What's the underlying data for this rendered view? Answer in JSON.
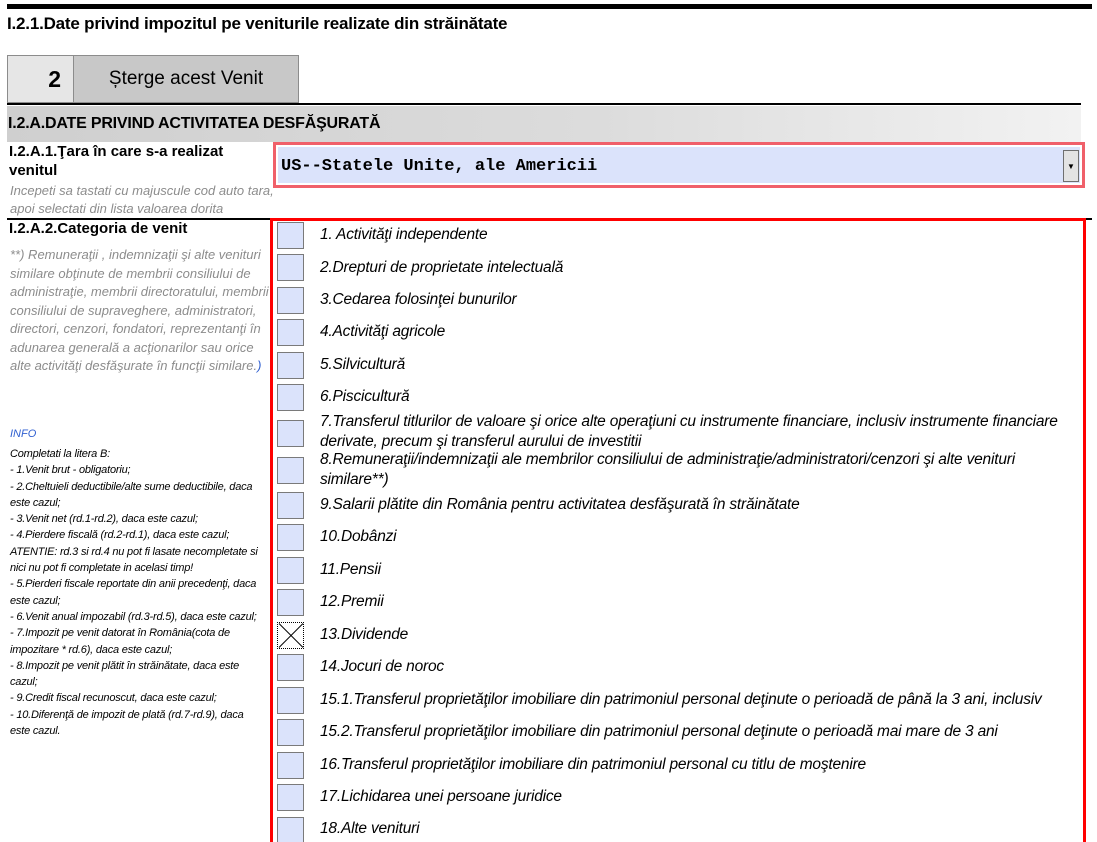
{
  "section": {
    "title": "I.2.1.Date privind impozitul pe veniturile realizate din străinătate"
  },
  "venit": {
    "number": "2",
    "delete_label": "Șterge acest Venit"
  },
  "activity": {
    "header": "I.2.A.DATE PRIVIND ACTIVITATEA DESFĂŞURATĂ",
    "country_label": "I.2.A.1.Ţara în care s-a realizat venitul",
    "country_hint": "Incepeti sa tastati cu majuscule cod auto tara, apoi selectati din lista valoarea dorita",
    "country_value": "US--Statele Unite, ale Americii",
    "category_label": "I.2.A.2.Categoria de venit",
    "category_note": "**) Remuneraţii , indemnizaţii şi alte venituri similare obţinute de membrii consiliului de administraţie, membrii directoratului, membrii consiliului de supraveghere, administratori, directori, cenzori, fondatori, reprezentanţi în adunarea generală a acţionarilor sau orice alte activităţi desfăşurate în funcţii similare.",
    "category_note_end": ")"
  },
  "info": {
    "title": "INFO",
    "lines": [
      "Completati la litera B:",
      "- 1.Venit brut - obligatoriu;",
      "- 2.Cheltuieli deductibile/alte sume deductibile, daca este cazul;",
      "- 3.Venit net (rd.1-rd.2), daca este cazul;",
      "- 4.Pierdere fiscală (rd.2-rd.1), daca este cazul;",
      "ATENTIE: rd.3 si rd.4 nu pot fi lasate necompletate si nici nu pot fi completate in acelasi timp!",
      "- 5.Pierderi fiscale reportate din anii precedenţi, daca este cazul;",
      "- 6.Venit anual impozabil (rd.3-rd.5), daca este cazul;",
      "- 7.Impozit pe venit datorat în România(cota de impozitare * rd.6), daca este cazul;",
      "- 8.Impozit pe venit plătit în străinătate, daca este cazul;",
      "- 9.Credit fiscal recunoscut, daca este cazul;",
      "- 10.Diferenţă de impozit de plată (rd.7-rd.9), daca este cazul."
    ]
  },
  "categories": [
    {
      "label": "1. Activităţi independente",
      "checked": false
    },
    {
      "label": "2.Drepturi de proprietate intelectuală",
      "checked": false
    },
    {
      "label": "3.Cedarea folosinţei bunurilor",
      "checked": false
    },
    {
      "label": "4.Activităţi agricole",
      "checked": false
    },
    {
      "label": "5.Silvicultură",
      "checked": false
    },
    {
      "label": "6.Piscicultură",
      "checked": false
    },
    {
      "label": "7.Transferul titlurilor de valoare şi orice alte operaţiuni cu instrumente financiare, inclusiv instrumente financiare derivate, precum şi transferul aurului de investitii",
      "checked": false
    },
    {
      "label": "8.Remuneraţii/indemnizaţii ale membrilor consiliului de administraţie/administratori/cenzori şi alte venituri similare**)",
      "checked": false
    },
    {
      "label": "9.Salarii plătite din România pentru activitatea desfăşurată în străinătate",
      "checked": false
    },
    {
      "label": "10.Dobânzi",
      "checked": false
    },
    {
      "label": "11.Pensii",
      "checked": false
    },
    {
      "label": "12.Premii",
      "checked": false
    },
    {
      "label": "13.Dividende",
      "checked": true
    },
    {
      "label": "14.Jocuri de noroc",
      "checked": false
    },
    {
      "label": "15.1.Transferul proprietăţilor imobiliare din patrimoniul personal deţinute o perioadă de până la 3 ani, inclusiv",
      "checked": false
    },
    {
      "label": "15.2.Transferul proprietăţilor imobiliare din patrimoniul personal deţinute o perioadă mai mare de 3 ani",
      "checked": false
    },
    {
      "label": "16.Transferul proprietăţilor imobiliare din patrimoniul personal cu titlu de moştenire",
      "checked": false
    },
    {
      "label": "17.Lichidarea unei persoane juridice",
      "checked": false
    },
    {
      "label": "18.Alte venituri",
      "checked": false
    }
  ]
}
